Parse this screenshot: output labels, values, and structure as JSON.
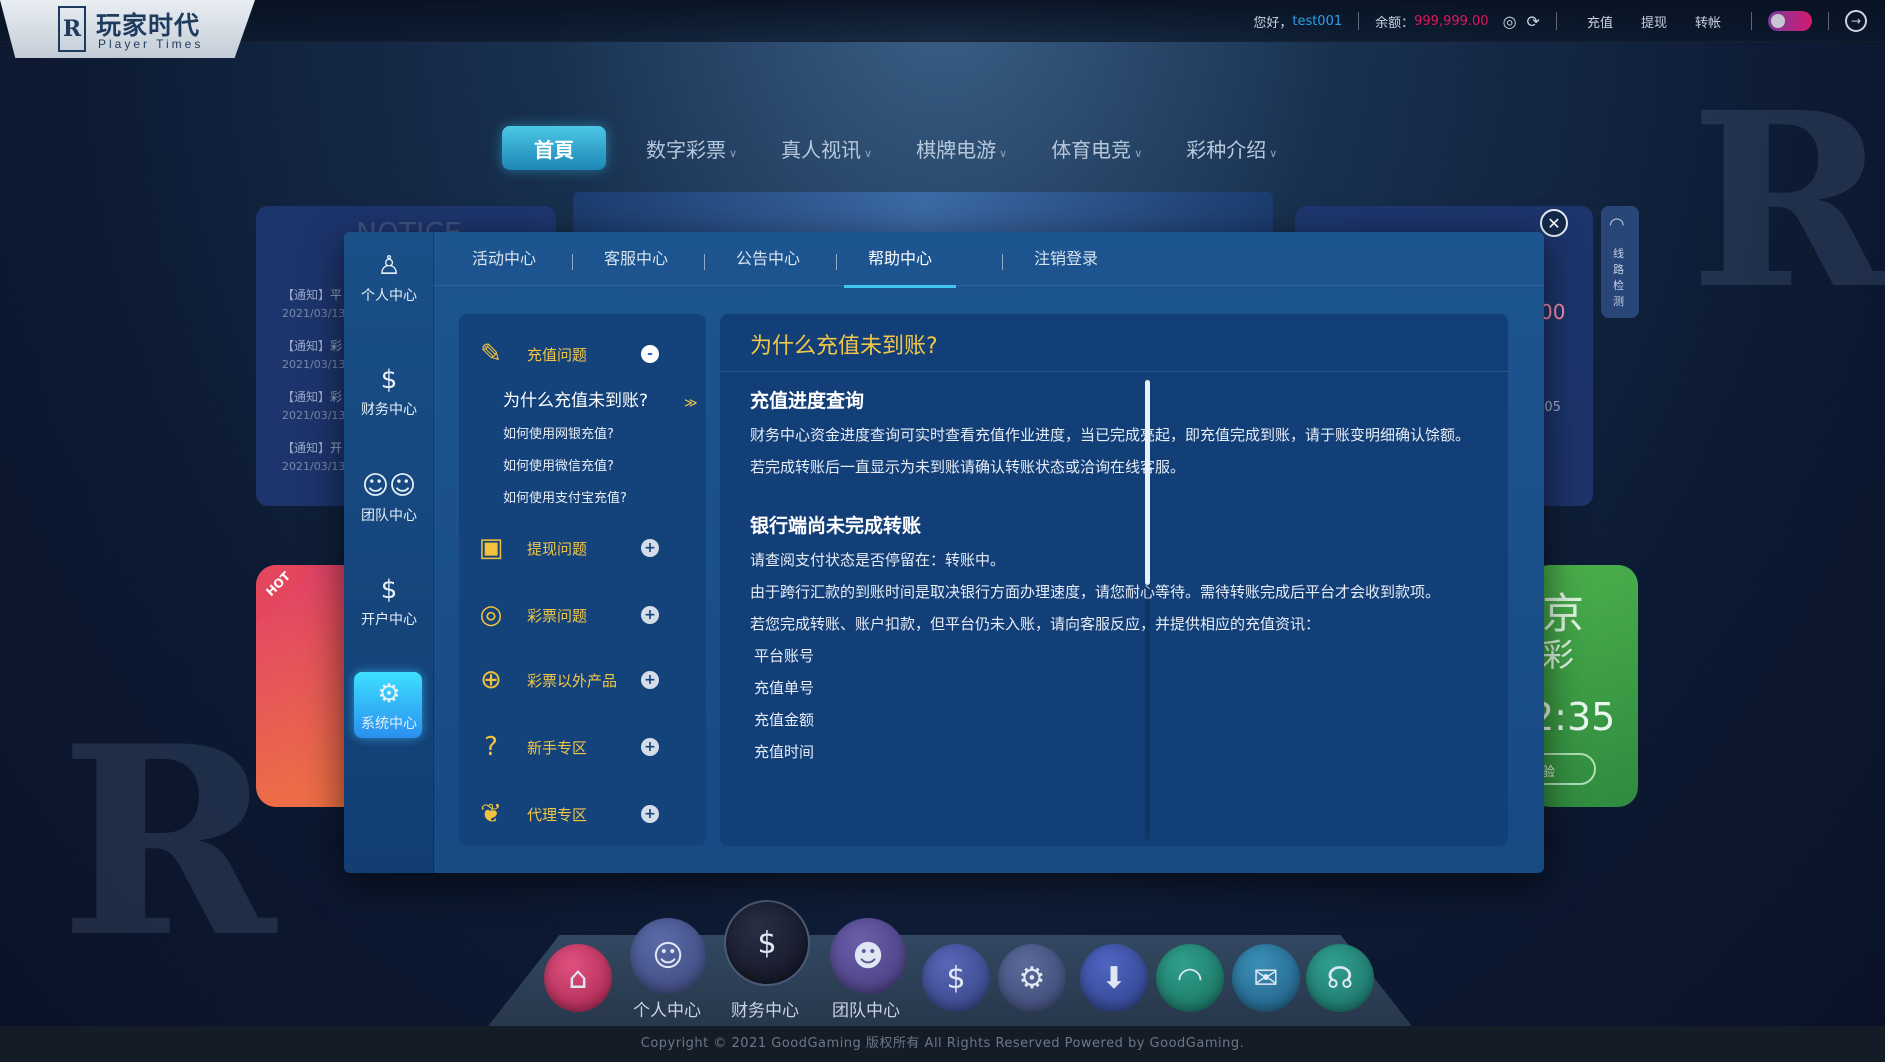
{
  "brand": {
    "cn": "玩家时代",
    "en": "Player Times",
    "mark": "R"
  },
  "topbar": {
    "greeting": "您好，",
    "username": "test001",
    "balance_label": "余额：",
    "balance_value": "999,999.00",
    "links": [
      "充值",
      "提现",
      "转帐"
    ]
  },
  "nav": {
    "home": "首頁",
    "items": [
      "数字彩票",
      "真人视讯",
      "棋牌电游",
      "体育电竞",
      "彩种介绍"
    ]
  },
  "background": {
    "notices": [
      {
        "text": "【通知】平",
        "date": "2021/03/13"
      },
      {
        "text": "【通知】彩",
        "date": "2021/03/13"
      },
      {
        "text": "【通知】彩",
        "date": "2021/03/13"
      },
      {
        "text": "【通知】开",
        "date": "2021/03/13"
      }
    ],
    "notice_heading": "NOTICE",
    "right_num": "00",
    "right_time": ":05",
    "linecheck": "线路检测",
    "hot": "HOT",
    "card_right_title1": "京",
    "card_right_title2": "彩",
    "card_right_time": "2:35",
    "card_right_btn": "验"
  },
  "modal": {
    "sidebar": [
      {
        "label": "个人中心",
        "icon": "user-icon"
      },
      {
        "label": "财务中心",
        "icon": "money-bag-icon"
      },
      {
        "label": "团队中心",
        "icon": "team-icon"
      },
      {
        "label": "开户中心",
        "icon": "open-account-icon"
      },
      {
        "label": "系统中心",
        "icon": "gear-icon"
      }
    ],
    "tabs": [
      "活动中心",
      "客服中心",
      "公告中心",
      "帮助中心",
      "注销登录"
    ],
    "active_tab": "帮助中心",
    "categories": [
      {
        "label": "充值问题",
        "toggle": "-"
      },
      {
        "label": "提现问题",
        "toggle": "+"
      },
      {
        "label": "彩票问题",
        "toggle": "+"
      },
      {
        "label": "彩票以外产品",
        "toggle": "+"
      },
      {
        "label": "新手专区",
        "toggle": "+"
      },
      {
        "label": "代理专区",
        "toggle": "+"
      }
    ],
    "sub_questions": [
      "为什么充值未到账?",
      "如何使用网银充值?",
      "如何使用微信充值?",
      "如何使用支付宝充值?"
    ],
    "sub_arrow": "≫",
    "content": {
      "title": "为什么充值未到账?",
      "sections": [
        {
          "heading": "充值进度查询",
          "paras": [
            "财务中心资金进度查询可实时查看充值作业进度，当已完成亮起，即充值完成到账，请于账变明细确认馀额。",
            "若完成转账后一直显示为未到账请确认转账状态或洽询在线客服。"
          ]
        },
        {
          "heading": "银行端尚未完成转账",
          "paras": [
            "请查阅支付状态是否停留在：转账中。",
            "由于跨行汇款的到账时间是取决银行方面办理速度，请您耐心等待。需待转账完成后平台才会收到款项。",
            "若您完成转账、账户扣款，但平台仍未入账，请向客服反应，并提供相应的充值资讯："
          ],
          "list": [
            "平台账号",
            "充值单号",
            "充值金额",
            "充值时间"
          ]
        }
      ]
    }
  },
  "dock": {
    "labels": [
      "个人中心",
      "财务中心",
      "团队中心"
    ]
  },
  "footer": "Copyright © 2021 GoodGaming 版权所有 All Rights Reserved Powered by GoodGaming."
}
